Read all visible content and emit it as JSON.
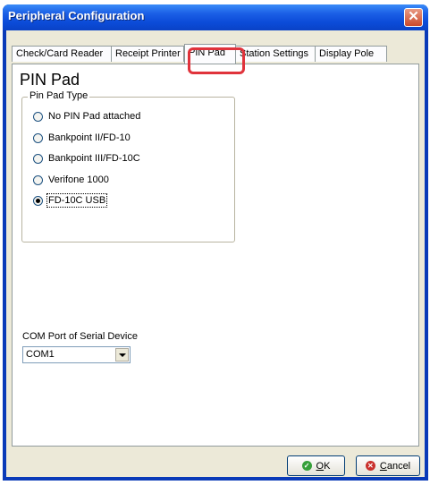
{
  "window": {
    "title": "Peripheral Configuration",
    "close_glyph": "✕"
  },
  "tabs": [
    {
      "label": "Check/Card Reader"
    },
    {
      "label": "Receipt Printer"
    },
    {
      "label": "PIN Pad"
    },
    {
      "label": "Station Settings"
    },
    {
      "label": "Display Pole"
    }
  ],
  "active_tab": "PIN Pad",
  "panel": {
    "title": "PIN Pad",
    "group": {
      "legend": "Pin Pad Type",
      "options": [
        {
          "label": "No PIN Pad attached",
          "checked": false
        },
        {
          "label": "Bankpoint II/FD-10",
          "checked": false
        },
        {
          "label": "Bankpoint III/FD-10C",
          "checked": false
        },
        {
          "label": "Verifone 1000",
          "checked": false
        },
        {
          "label": "FD-10C USB",
          "checked": true
        }
      ]
    },
    "com_port": {
      "label": "COM Port of Serial Device",
      "value": "COM1"
    }
  },
  "buttons": {
    "ok": {
      "label": "OK",
      "icon": "checkmark-icon",
      "color": "#36a03a"
    },
    "cancel": {
      "label": "Cancel",
      "icon": "cancel-x-icon",
      "color": "#c9302c"
    }
  },
  "colors": {
    "titlebar": "#0b4bd8",
    "highlight": "#e0333b",
    "face": "#ece9d8"
  }
}
